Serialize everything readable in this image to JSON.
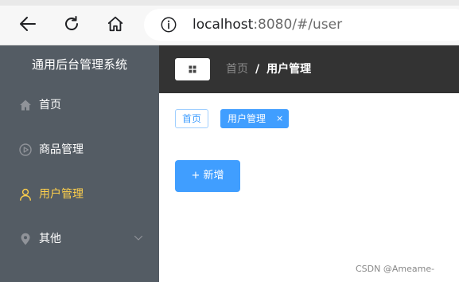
{
  "browser": {
    "url_host": "localhost",
    "url_rest": ":8080/#/user"
  },
  "sidebar": {
    "title": "通用后台管理系统",
    "items": [
      {
        "label": "首页",
        "icon": "home-icon"
      },
      {
        "label": "商品管理",
        "icon": "play-circle-icon"
      },
      {
        "label": "用户管理",
        "icon": "user-icon",
        "active": true
      },
      {
        "label": "其他",
        "icon": "location-icon",
        "has_submenu": true
      }
    ]
  },
  "header": {
    "breadcrumb": {
      "home": "首页",
      "separator": "/",
      "current": "用户管理"
    }
  },
  "tags": [
    {
      "label": "首页"
    },
    {
      "label": "用户管理",
      "closable": true,
      "close_glyph": "×"
    }
  ],
  "main": {
    "add_button_label": "+ 新增"
  },
  "watermark": "CSDN @Ameame-",
  "colors": {
    "sidebar_bg": "#545c64",
    "active_text": "#ffd04b",
    "header_bg": "#333333",
    "primary": "#409eff"
  }
}
